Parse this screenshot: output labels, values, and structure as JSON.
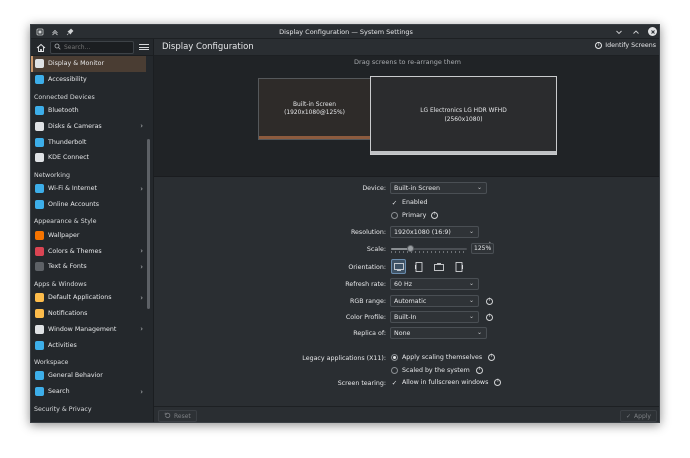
{
  "window": {
    "title": "Display Configuration — System Settings"
  },
  "sidebar": {
    "search_placeholder": "Search...",
    "items": [
      {
        "label": "Display & Monitor",
        "icon": "monitor-icon",
        "color": "#dfe2e5",
        "active": true
      },
      {
        "label": "Accessibility",
        "icon": "accessibility-icon",
        "color": "#3daee9"
      },
      {
        "category": "Connected Devices"
      },
      {
        "label": "Bluetooth",
        "icon": "bluetooth-icon",
        "color": "#3daee9"
      },
      {
        "label": "Disks & Cameras",
        "icon": "disks-icon",
        "color": "#dfe2e5",
        "has_children": true
      },
      {
        "label": "Thunderbolt",
        "icon": "thunderbolt-icon",
        "color": "#3daee9"
      },
      {
        "label": "KDE Connect",
        "icon": "kde-connect-icon",
        "color": "#dfe2e5"
      },
      {
        "category": "Networking"
      },
      {
        "label": "Wi-Fi & Internet",
        "icon": "globe-icon",
        "color": "#3daee9",
        "has_children": true
      },
      {
        "label": "Online Accounts",
        "icon": "online-accounts-icon",
        "color": "#3daee9"
      },
      {
        "category": "Appearance & Style"
      },
      {
        "label": "Wallpaper",
        "icon": "wallpaper-icon",
        "color": "#f67400"
      },
      {
        "label": "Colors & Themes",
        "icon": "colors-icon",
        "color": "#da4453",
        "has_children": true
      },
      {
        "label": "Text & Fonts",
        "icon": "fonts-icon",
        "color": "#5d6166",
        "has_children": true
      },
      {
        "category": "Apps & Windows"
      },
      {
        "label": "Default Applications",
        "icon": "star-icon",
        "color": "#fdbc4b",
        "has_children": true
      },
      {
        "label": "Notifications",
        "icon": "bell-icon",
        "color": "#fdbc4b"
      },
      {
        "label": "Window Management",
        "icon": "window-icon",
        "color": "#dfe2e5",
        "has_children": true
      },
      {
        "label": "Activities",
        "icon": "activities-icon",
        "color": "#3daee9"
      },
      {
        "category": "Workspace"
      },
      {
        "label": "General Behavior",
        "icon": "general-behavior-icon",
        "color": "#3daee9"
      },
      {
        "label": "Search",
        "icon": "search-icon",
        "color": "#3daee9",
        "has_children": true
      },
      {
        "category": "Security & Privacy"
      }
    ]
  },
  "header": {
    "title": "Display Configuration",
    "identify_label": "Identify Screens"
  },
  "arrange": {
    "hint": "Drag screens to re-arrange them",
    "screens": [
      {
        "name": "Built-in Screen",
        "detail": "(1920x1080@125%)"
      },
      {
        "name": "LG Electronics LG HDR WFHD",
        "detail": "(2560x1080)"
      }
    ]
  },
  "form": {
    "device": {
      "label": "Device:",
      "value": "Built-in Screen"
    },
    "enabled_label": "Enabled",
    "primary_label": "Primary",
    "resolution": {
      "label": "Resolution:",
      "value": "1920x1080 (16:9)"
    },
    "scale": {
      "label": "Scale:",
      "value": "125%",
      "level": 0.25
    },
    "orientation": {
      "label": "Orientation:"
    },
    "refresh": {
      "label": "Refresh rate:",
      "value": "60 Hz"
    },
    "rgb": {
      "label": "RGB range:",
      "value": "Automatic"
    },
    "color_profile": {
      "label": "Color Profile:",
      "value": "Built-In"
    },
    "replica": {
      "label": "Replica of:",
      "value": "None"
    },
    "legacy": {
      "label": "Legacy applications (X11):",
      "option1": "Apply scaling themselves",
      "option2": "Scaled by the system"
    },
    "tearing": {
      "label": "Screen tearing:",
      "option": "Allow in fullscreen windows"
    }
  },
  "footer": {
    "reset_label": "Reset",
    "apply_label": "Apply"
  },
  "colors": {
    "accent": "#3daee9",
    "active_item": "#4a3d33",
    "background": "#2a2e32"
  }
}
